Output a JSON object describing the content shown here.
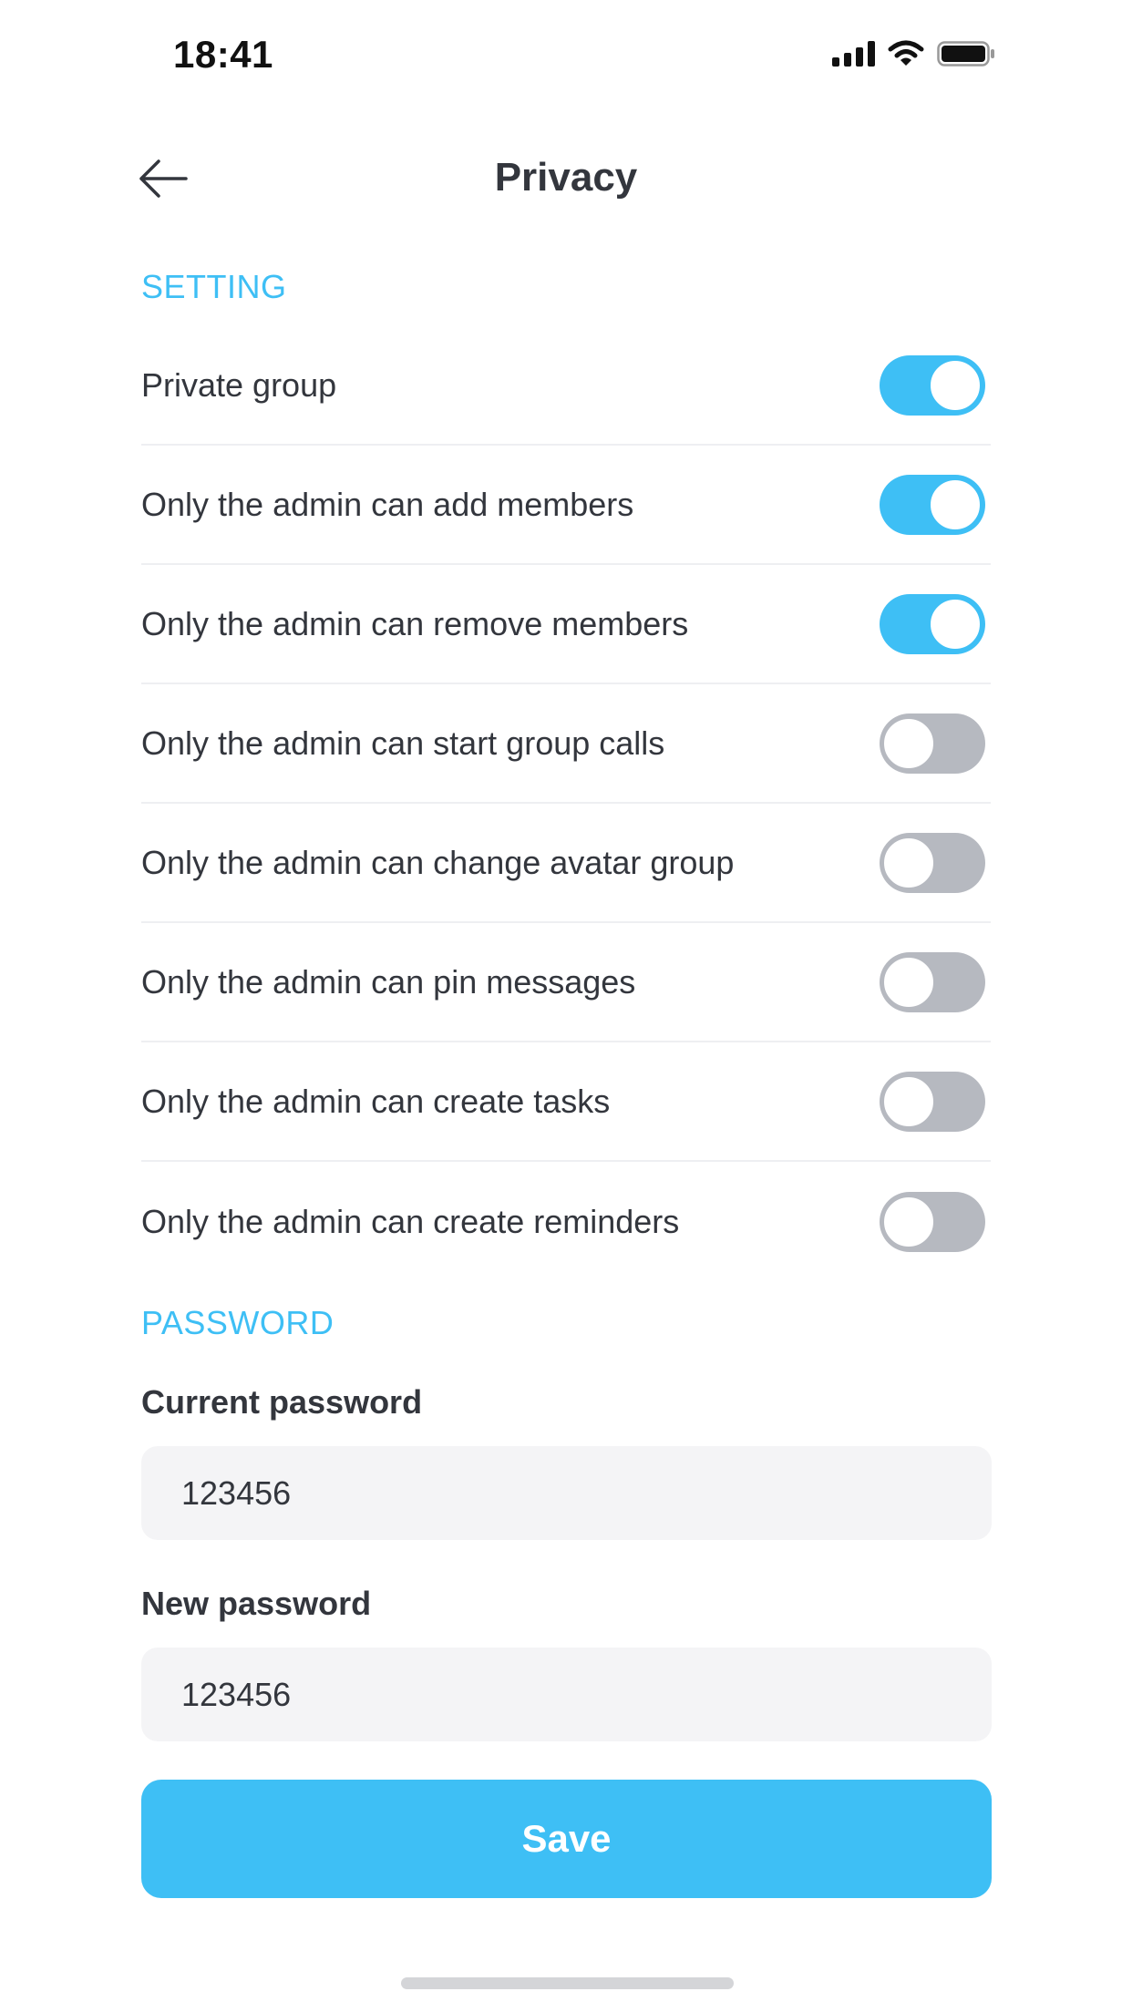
{
  "status_bar": {
    "time": "18:41",
    "icons": [
      "signal-icon",
      "wifi-icon",
      "battery-icon"
    ]
  },
  "header": {
    "back_icon": "arrow-left-icon",
    "title": "Privacy"
  },
  "setting_section": {
    "label": "SETTING",
    "toggles": [
      {
        "label": "Private group",
        "on": true
      },
      {
        "label": "Only the admin can add members",
        "on": true
      },
      {
        "label": "Only the admin can remove members",
        "on": true
      },
      {
        "label": "Only the admin can start group calls",
        "on": false
      },
      {
        "label": "Only the admin can change avatar group",
        "on": false
      },
      {
        "label": "Only the admin can pin messages",
        "on": false
      },
      {
        "label": "Only the admin can create tasks",
        "on": false
      },
      {
        "label": "Only the admin can create reminders",
        "on": false
      }
    ]
  },
  "password_section": {
    "label": "PASSWORD",
    "current_password": {
      "label": "Current password",
      "value": "123456"
    },
    "new_password": {
      "label": "New password",
      "value": "123456"
    }
  },
  "save_button": {
    "label": "Save"
  },
  "colors": {
    "accent": "#3ebff5",
    "toggle_off": "#b6b9c0",
    "text": "#33363d",
    "input_bg": "#f4f4f6"
  }
}
